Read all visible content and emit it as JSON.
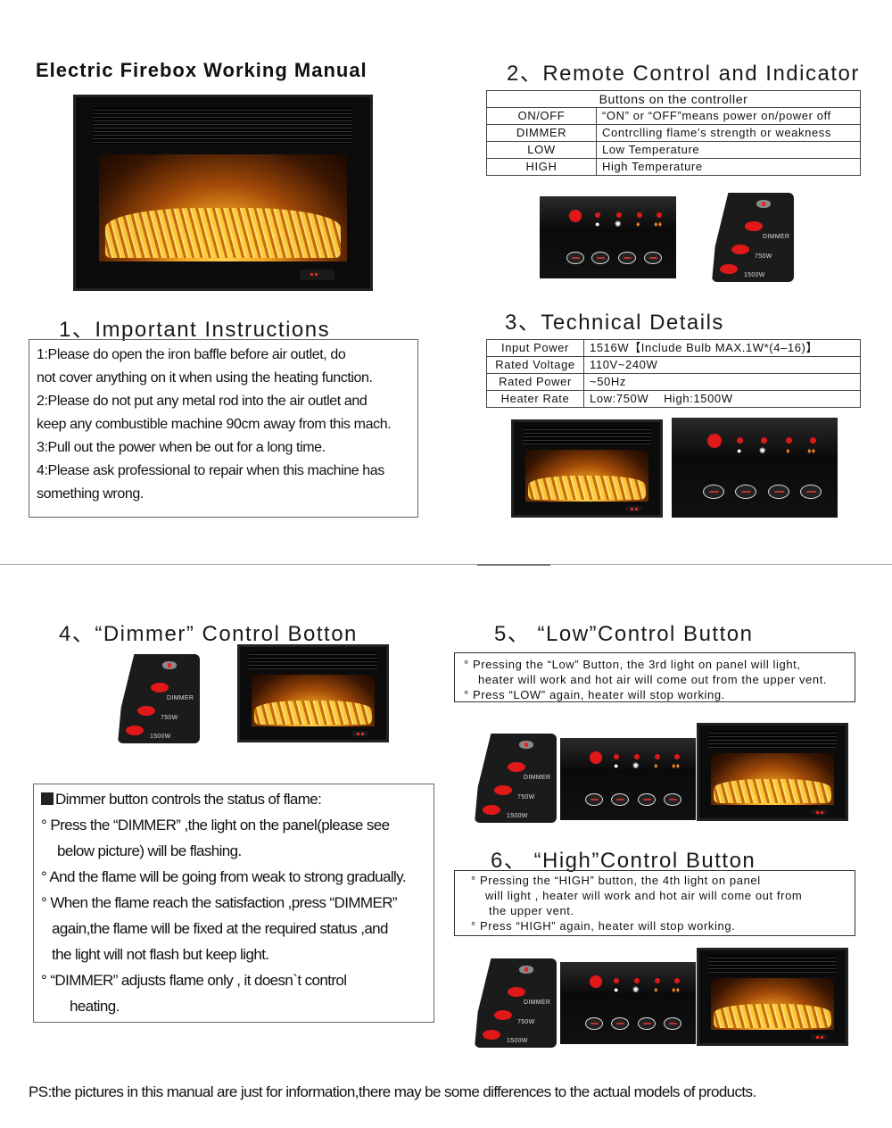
{
  "title": "Electric Firebox Working Manual",
  "sections": {
    "instructions": {
      "heading": "1、Important  Instructions",
      "lines": [
        "1:Please do open the iron baffle before air outlet, do",
        "not cover  anything on it when using the  heating  function.",
        "2:Please do not put any metal rod into the air outlet and",
        "keep any combustible machine 90cm away from this mach.",
        "3:Pull out the power when be out for a long time.",
        "4:Please ask professional to repair when this machine has",
        "something wrong."
      ]
    },
    "remote": {
      "heading": "2、Remote Control and Indicator",
      "table_title": "Buttons on the controller",
      "rows": [
        {
          "button": "ON/OFF",
          "desc": "“ON” or “OFF”means power on/power off"
        },
        {
          "button": "DIMMER",
          "desc": "Contrclling flame's strength or weakness"
        },
        {
          "button": "LOW",
          "desc": "Low Temperature"
        },
        {
          "button": "HIGH",
          "desc": "High Temperature"
        }
      ]
    },
    "technical": {
      "heading": "3、Technical Details",
      "rows": [
        {
          "label": "Input Power",
          "value": "1516W【Include Bulb MAX.1W*(4–16)】"
        },
        {
          "label": "Rated Voltage",
          "value": "110V~240W"
        },
        {
          "label": "Rated Power",
          "value": "~50Hz"
        },
        {
          "label": "Heater Rate",
          "value": "Low:750W    High:1500W"
        }
      ]
    },
    "dimmer": {
      "heading": "4、“Dimmer”  Control Botton",
      "box_title": "Dimmer button controls the status of flame:",
      "bullets": [
        {
          "lines": [
            "Press the  “DIMMER” ,the light on the panel(please see",
            "below picture) will be flashing."
          ]
        },
        {
          "lines": [
            "And the flame will be going from weak to strong gradually."
          ]
        },
        {
          "lines": [
            "When the flame reach  the  satisfaction ,press “DIMMER”",
            "again,the flame will be fixed at  the  required status ,and",
            "the light will not flash but keep light."
          ]
        },
        {
          "lines": [
            "“DIMMER”  adjusts flame  only , it doesn`t   control",
            "heating."
          ]
        }
      ]
    },
    "low": {
      "heading": "5、 “Low”Control Button",
      "bullets": [
        {
          "lines": [
            "Pressing the  “Low”  Button, the 3rd light on panel will light,",
            "heater will work and hot air will come out from the upper vent."
          ]
        },
        {
          "lines": [
            "Press “LOW” again, heater will stop working."
          ]
        }
      ]
    },
    "high": {
      "heading": "6、 “High”Control Button",
      "bullets": [
        {
          "lines": [
            "Pressing the  “HIGH” button,  the 4th light   on panel",
            "will light , heater will work and hot air will come out from",
            "the upper vent."
          ]
        },
        {
          "lines": [
            "Press  “HIGH” again, heater will stop working."
          ]
        }
      ]
    }
  },
  "remote_labels": {
    "dimmer": "DIMMER",
    "low": "750W",
    "high": "1500W"
  },
  "footer": "PS:the pictures in this manual are just for information,there may be some differences  to the actual models of products.",
  "colors": {
    "led_red": "#e11818",
    "flame_orange": "#f0a020"
  }
}
